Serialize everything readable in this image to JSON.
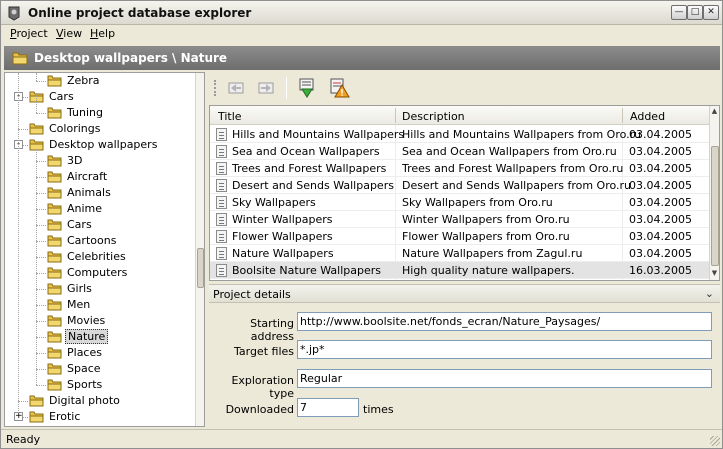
{
  "window": {
    "title": "Online project database explorer"
  },
  "menu": {
    "items": [
      {
        "label": "Project"
      },
      {
        "label": "View"
      },
      {
        "label": "Help"
      }
    ]
  },
  "breadcrumb": {
    "text": "Desktop wallpapers \\ Nature"
  },
  "tree": {
    "items": [
      {
        "label": "Zebra",
        "level": 2,
        "expander": "",
        "selected": false
      },
      {
        "label": "Cars",
        "level": 1,
        "expander": "-",
        "selected": false
      },
      {
        "label": "Tuning",
        "level": 2,
        "expander": "",
        "selected": false
      },
      {
        "label": "Colorings",
        "level": 1,
        "expander": "",
        "selected": false
      },
      {
        "label": "Desktop wallpapers",
        "level": 1,
        "expander": "-",
        "selected": false
      },
      {
        "label": "3D",
        "level": 2,
        "expander": "",
        "selected": false
      },
      {
        "label": "Aircraft",
        "level": 2,
        "expander": "",
        "selected": false
      },
      {
        "label": "Animals",
        "level": 2,
        "expander": "",
        "selected": false
      },
      {
        "label": "Anime",
        "level": 2,
        "expander": "",
        "selected": false
      },
      {
        "label": "Cars",
        "level": 2,
        "expander": "",
        "selected": false
      },
      {
        "label": "Cartoons",
        "level": 2,
        "expander": "",
        "selected": false
      },
      {
        "label": "Celebrities",
        "level": 2,
        "expander": "",
        "selected": false
      },
      {
        "label": "Computers",
        "level": 2,
        "expander": "",
        "selected": false
      },
      {
        "label": "Girls",
        "level": 2,
        "expander": "",
        "selected": false
      },
      {
        "label": "Men",
        "level": 2,
        "expander": "",
        "selected": false
      },
      {
        "label": "Movies",
        "level": 2,
        "expander": "",
        "selected": false
      },
      {
        "label": "Nature",
        "level": 2,
        "expander": "",
        "selected": true
      },
      {
        "label": "Places",
        "level": 2,
        "expander": "",
        "selected": false
      },
      {
        "label": "Space",
        "level": 2,
        "expander": "",
        "selected": false
      },
      {
        "label": "Sports",
        "level": 2,
        "expander": "",
        "selected": false
      },
      {
        "label": "Digital photo",
        "level": 1,
        "expander": "",
        "selected": false
      },
      {
        "label": "Erotic",
        "level": 1,
        "expander": "+",
        "selected": false
      }
    ]
  },
  "toolbar": {
    "back_icon": "back-arrow-icon",
    "forward_icon": "forward-arrow-icon",
    "download_icon": "download-icon",
    "warning_icon": "warning-icon"
  },
  "grid": {
    "columns": [
      "Title",
      "Description",
      "Added"
    ],
    "rows": [
      {
        "title": "Hills and Mountains Wallpapers",
        "description": "Hills and Mountains Wallpapers from Oro.ru",
        "added": "03.04.2005"
      },
      {
        "title": "Sea and Ocean Wallpapers",
        "description": "Sea and Ocean Wallpapers from Oro.ru",
        "added": "03.04.2005"
      },
      {
        "title": "Trees and Forest Wallpapers",
        "description": "Trees and Forest Wallpapers from Oro.ru",
        "added": "03.04.2005"
      },
      {
        "title": "Desert and Sends Wallpapers",
        "description": "Desert and Sends Wallpapers from Oro.ru",
        "added": "03.04.2005"
      },
      {
        "title": "Sky Wallpapers",
        "description": "Sky Wallpapers from Oro.ru",
        "added": "03.04.2005"
      },
      {
        "title": "Winter Wallpapers",
        "description": "Winter Wallpapers from Oro.ru",
        "added": "03.04.2005"
      },
      {
        "title": "Flower Wallpapers",
        "description": "Flower Wallpapers from Oro.ru",
        "added": "03.04.2005"
      },
      {
        "title": "Nature Wallpapers",
        "description": "Nature Wallpapers from Zagul.ru",
        "added": "03.04.2005"
      },
      {
        "title": "Boolsite Nature Wallpapers",
        "description": "High quality nature wallpapers.",
        "added": "16.03.2005"
      }
    ],
    "selected_index": 8
  },
  "details": {
    "title": "Project details",
    "starting_address_label": "Starting address",
    "starting_address_value": "http://www.boolsite.net/fonds_ecran/Nature_Paysages/",
    "target_files_label": "Target files",
    "target_files_value": "*.jp*",
    "exploration_type_label": "Exploration type",
    "exploration_type_value": "Regular",
    "downloaded_label": "Downloaded",
    "downloaded_value": "7",
    "downloaded_suffix": "times"
  },
  "status": {
    "text": "Ready"
  },
  "colors": {
    "header_band": "#7c7c7c",
    "folder": "#e8c24a",
    "selection": "#e3e3e3"
  }
}
